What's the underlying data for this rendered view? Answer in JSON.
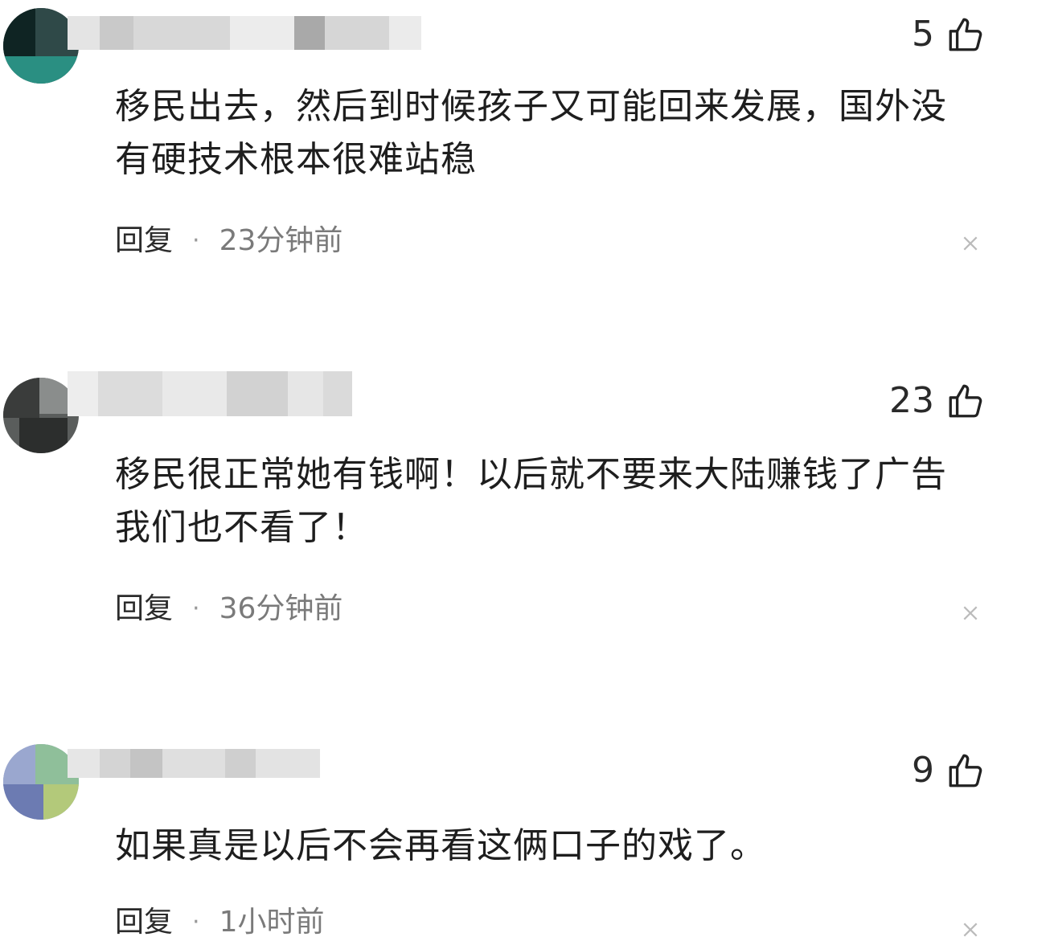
{
  "comments": [
    {
      "likes": "5",
      "text": "移民出去，然后到时候孩子又可能回来发展，国外没有硬技术根本很难站稳",
      "reply_label": "回复",
      "separator": "·",
      "time": "23分钟前"
    },
    {
      "likes": "23",
      "text": "移民很正常她有钱啊！以后就不要来大陆赚钱了广告我们也不看了！",
      "reply_label": "回复",
      "separator": "·",
      "time": "36分钟前"
    },
    {
      "likes": "9",
      "text": "如果真是以后不会再看这俩口子的戏了。",
      "reply_label": "回复",
      "separator": "·",
      "time": "1小时前"
    }
  ],
  "icons": {
    "like": "thumbs-up-icon",
    "dismiss": "close-icon"
  },
  "colors": {
    "text": "#1e1e1e",
    "meta": "#7a7a7a",
    "icon": "#222222",
    "close": "#bbbbbb"
  }
}
